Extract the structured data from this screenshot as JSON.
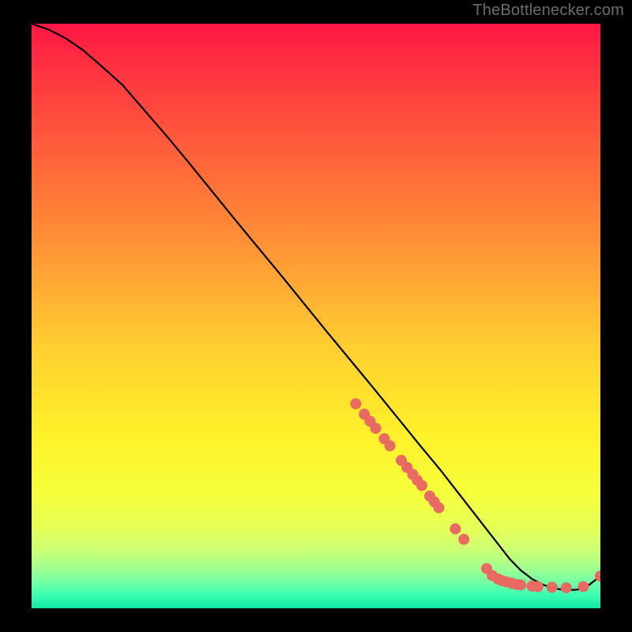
{
  "attribution_text": "TheBottlenecker.com",
  "gradient": {
    "stops": [
      {
        "offset": 0.0,
        "color": "#ff1744"
      },
      {
        "offset": 0.1,
        "color": "#ff3a3f"
      },
      {
        "offset": 0.25,
        "color": "#ff6a3a"
      },
      {
        "offset": 0.4,
        "color": "#ff9a35"
      },
      {
        "offset": 0.55,
        "color": "#ffce30"
      },
      {
        "offset": 0.7,
        "color": "#fff02a"
      },
      {
        "offset": 0.8,
        "color": "#f6ff3a"
      },
      {
        "offset": 0.86,
        "color": "#e7ff55"
      },
      {
        "offset": 0.9,
        "color": "#ccff74"
      },
      {
        "offset": 0.93,
        "color": "#a3ff8f"
      },
      {
        "offset": 0.955,
        "color": "#73ffa4"
      },
      {
        "offset": 0.975,
        "color": "#3fffb3"
      },
      {
        "offset": 1.0,
        "color": "#11e8a6"
      }
    ]
  },
  "chart_data": {
    "type": "line",
    "title": "",
    "xlabel": "",
    "ylabel": "",
    "xlim": [
      0,
      100
    ],
    "ylim": [
      0,
      100
    ],
    "series": [
      {
        "name": "curve",
        "x": [
          0,
          3,
          6,
          9,
          12,
          16,
          20,
          24,
          28,
          32,
          36,
          40,
          44,
          48,
          52,
          56,
          60,
          64,
          68,
          72,
          74,
          76,
          78,
          80,
          82,
          84,
          86,
          88,
          90,
          92,
          94,
          96,
          97,
          98,
          100
        ],
        "y": [
          100,
          99,
          97.5,
          95.5,
          93,
          89.5,
          85,
          80.5,
          75.8,
          71,
          66.2,
          61.5,
          56.8,
          52,
          47.2,
          42.5,
          37.8,
          33,
          28.2,
          23.5,
          21,
          18.5,
          16,
          13.5,
          11,
          8.5,
          6.5,
          5,
          4,
          3.4,
          3.1,
          3.2,
          3.5,
          4,
          5.5
        ]
      }
    ],
    "markers": {
      "name": "points",
      "x": [
        57,
        58.5,
        59.5,
        60.5,
        62,
        63,
        65,
        66,
        67,
        67.8,
        68.6,
        70,
        70.8,
        71.6,
        74.5,
        76,
        80,
        81,
        82,
        82.8,
        83.6,
        84.4,
        85.2,
        86,
        88,
        89,
        91.5,
        94,
        97,
        100
      ],
      "y": [
        35,
        33.2,
        32.0,
        30.8,
        29,
        27.8,
        25.3,
        24.1,
        22.9,
        21.9,
        21.0,
        19.2,
        18.2,
        17.2,
        13.6,
        11.8,
        6.8,
        5.6,
        5.0,
        4.7,
        4.5,
        4.3,
        4.1,
        4.0,
        3.8,
        3.7,
        3.6,
        3.5,
        3.7,
        5.5
      ]
    },
    "marker_color": "#e86a62"
  }
}
